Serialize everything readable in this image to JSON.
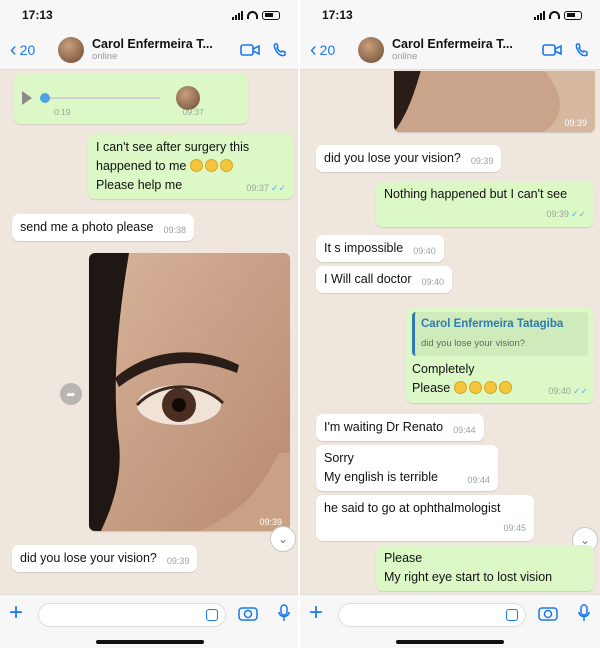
{
  "status": {
    "time": "17:13"
  },
  "header": {
    "back_count": "20",
    "contact_name": "Carol Enfermeira T...",
    "contact_status": "online"
  },
  "left": {
    "voice": {
      "elapsed": "0:19",
      "time": "09:37"
    },
    "msg1": {
      "line1": "I can't see after surgery this",
      "line2": "happened to me",
      "line3": "Please help me",
      "time": "09:37"
    },
    "msg2": {
      "text": "send me a photo please",
      "time": "09:38"
    },
    "photo_time": "09:39",
    "msg3": {
      "text": "did you lose your vision?",
      "time": "09:39"
    }
  },
  "right": {
    "photo_time": "09:39",
    "msg1": {
      "text": "did you lose your vision?",
      "time": "09:39"
    },
    "msg2": {
      "text": "Nothing happened but I can't see",
      "time": "09:39"
    },
    "msg3": {
      "text": "It s impossible",
      "time": "09:40"
    },
    "msg4": {
      "text": "I Will call doctor",
      "time": "09:40"
    },
    "reply": {
      "quote_name": "Carol Enfermeira Tatagiba",
      "quote_text": "did you lose your vision?",
      "line1": "Completely",
      "line2": "Please",
      "time": "09:40"
    },
    "msg5": {
      "text": "I'm waiting Dr Renato",
      "time": "09:44"
    },
    "msg6": {
      "line1": "Sorry",
      "line2": "My english is terrible",
      "time": "09:44"
    },
    "msg7": {
      "text": "he said to go at ophthalmologist",
      "time": "09:45"
    },
    "msg8": {
      "line1": "Please",
      "line2": "My right eye start to lost vision"
    }
  },
  "colors": {
    "accent": "#1877f2",
    "outgoing": "#dcf8c6",
    "incoming": "#ffffff",
    "wallpaper": "#efe7de",
    "read_ticks": "#4fb6ec"
  }
}
